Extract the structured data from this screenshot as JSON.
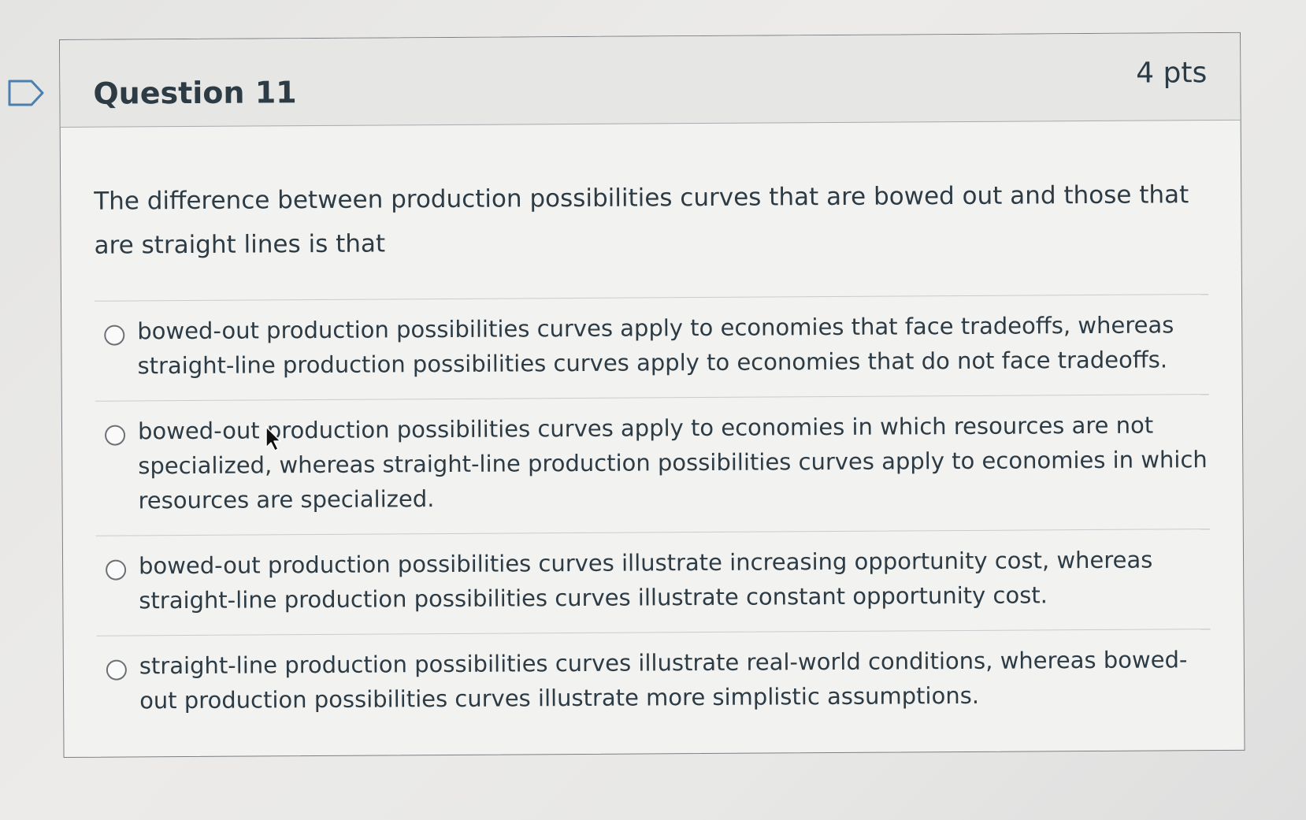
{
  "question": {
    "title": "Question 11",
    "points": "4 pts",
    "text": "The difference between production possibilities curves that are bowed out and those that are straight lines is that",
    "answers": [
      {
        "label": "bowed-out production possibilities curves apply to economies that face tradeoffs, whereas straight-line production possibilities curves apply to economies that do not face tradeoffs.",
        "selected": false
      },
      {
        "label": "bowed-out production possibilities curves apply to economies in which resources are not specialized, whereas straight-line production possibilities curves apply to economies in which resources are specialized.",
        "selected": false
      },
      {
        "label": "bowed-out production possibilities curves illustrate increasing opportunity cost, whereas straight-line production possibilities curves illustrate constant opportunity cost.",
        "selected": false
      },
      {
        "label": "straight-line production possibilities curves illustrate real-world conditions, whereas bowed-out production possibilities curves illustrate more simplistic assumptions.",
        "selected": false
      }
    ]
  },
  "icons": {
    "flag": "flag-outline-icon",
    "cursor": "mouse-pointer-icon"
  },
  "colors": {
    "text": "#2d3b45",
    "header_bg": "#e6e6e5",
    "border": "#7b7f83"
  }
}
